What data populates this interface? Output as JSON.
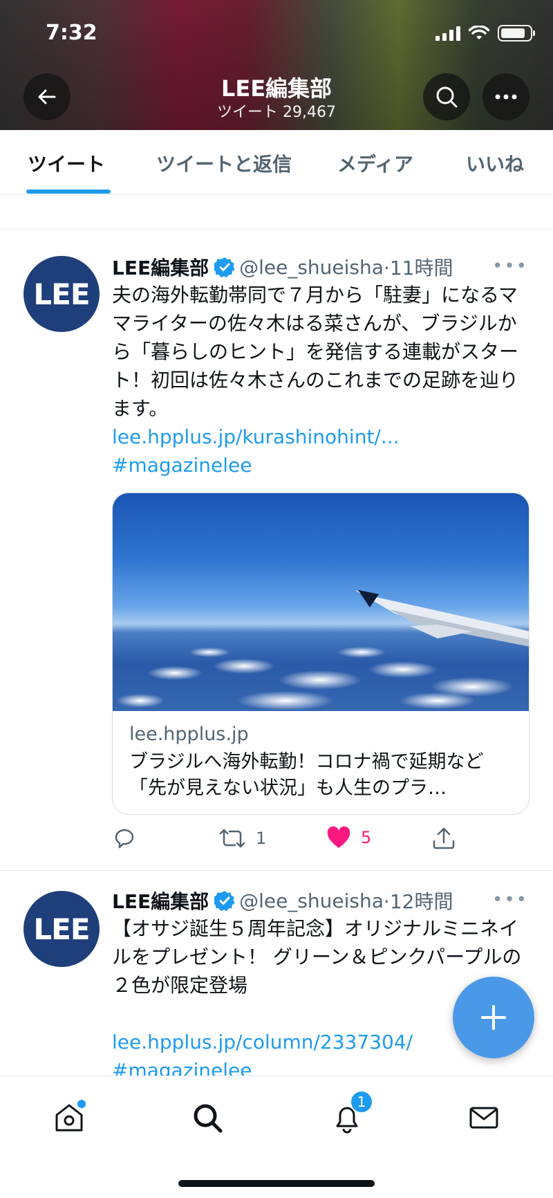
{
  "status_bar": {
    "time": "7:32"
  },
  "header": {
    "title": "LEE編集部",
    "subtitle": "ツイート 29,467"
  },
  "tabs": [
    {
      "label": "ツイート",
      "active": true
    },
    {
      "label": "ツイートと返信",
      "active": false
    },
    {
      "label": "メディア",
      "active": false
    },
    {
      "label": "いいね",
      "active": false
    }
  ],
  "tweets": [
    {
      "avatar_text": "LEE",
      "author": "LEE編集部",
      "handle": "@lee_shueisha",
      "time": "·11時間",
      "text": "夫の海外転勤帯同で７月から「駐妻」になるママライターの佐々木はる菜さんが、ブラジルから「暮らしのヒント」を発信する連載がスタート！初回は佐々木さんのこれまでの足跡を辿ります。",
      "link": "lee.hpplus.jp/kurashinohint/...",
      "hashtag": "#magazinelee",
      "card": {
        "domain": "lee.hpplus.jp",
        "title": "ブラジルへ海外転勤！コロナ禍で延期など「先が見えない状況」も人生のプラ…"
      },
      "stats": {
        "retweets": "1",
        "likes": "5"
      }
    },
    {
      "avatar_text": "LEE",
      "author": "LEE編集部",
      "handle": "@lee_shueisha",
      "time": "·12時間",
      "text": "【オサジ誕生５周年記念】オリジナルミニネイルをプレゼント！ グリーン＆ピンクパープルの２色が限定登場",
      "link": "lee.hpplus.jp/column/2337304/",
      "hashtag": "#magazinelee"
    }
  ],
  "bottom_nav": {
    "notifications_count": "1"
  },
  "colors": {
    "accent": "#1d9bf0",
    "like": "#f91880",
    "avatar_bg": "#1f3f7a"
  }
}
